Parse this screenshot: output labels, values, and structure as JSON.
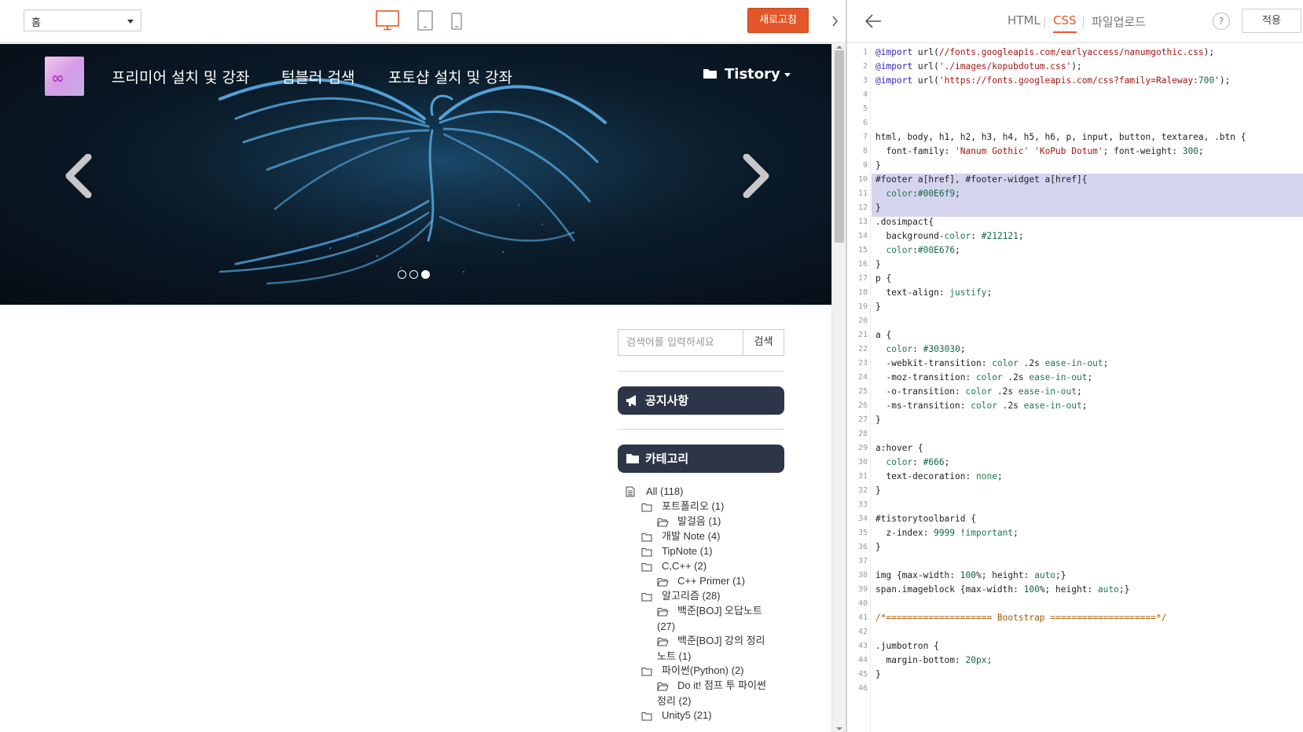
{
  "preview_toolbar": {
    "page_select_value": "홈",
    "device_icons": [
      "desktop-icon",
      "tablet-icon",
      "mobile-icon"
    ],
    "refresh_label": "새로고침",
    "accent_color": "#e4572a"
  },
  "blog": {
    "nav": [
      "프리미어 설치 및 강좌",
      "텀블러 검색",
      "포토샵 설치 및 강좌"
    ],
    "tistory_menu": "Tistory",
    "search_placeholder": "검색어를 입력하세요",
    "search_button": "검색",
    "notice_title": "공지사항",
    "category_title": "카테고리",
    "categories": [
      {
        "label": "All (118)",
        "level": 0,
        "icon": "document-icon"
      },
      {
        "label": "포트폴리오 (1)",
        "level": 1,
        "icon": "folder-icon"
      },
      {
        "label": "발걸음 (1)",
        "level": 2,
        "icon": "folder-open-icon"
      },
      {
        "label": "개발 Note (4)",
        "level": 1,
        "icon": "folder-icon"
      },
      {
        "label": "TipNote (1)",
        "level": 1,
        "icon": "folder-icon"
      },
      {
        "label": "C,C++ (2)",
        "level": 1,
        "icon": "folder-icon"
      },
      {
        "label": "C++ Primer (1)",
        "level": 2,
        "icon": "folder-open-icon"
      },
      {
        "label": "알고리즘 (28)",
        "level": 1,
        "icon": "folder-icon"
      },
      {
        "label": "백준[BOJ] 오답노트",
        "cont": "(27)",
        "level": 2,
        "icon": "folder-open-icon"
      },
      {
        "label": "백준[BOJ] 강의 정리",
        "cont": "노트 (1)",
        "level": 2,
        "icon": "folder-open-icon"
      },
      {
        "label": "파이썬(Python) (2)",
        "level": 1,
        "icon": "folder-icon"
      },
      {
        "label": "Do it! 점프 투 파이썬",
        "cont": "정리 (2)",
        "level": 2,
        "icon": "folder-open-icon"
      },
      {
        "label": "Unity5 (21)",
        "level": 1,
        "icon": "folder-icon"
      }
    ]
  },
  "editor": {
    "tabs": [
      "HTML",
      "CSS",
      "파일업로드"
    ],
    "active_tab": "CSS",
    "help_label": "?",
    "apply_label": "적용",
    "highlighted_lines": [
      10,
      11,
      12
    ],
    "code_lines": [
      "@import url(//fonts.googleapis.com/earlyaccess/nanumgothic.css);",
      "@import url('./images/kopubdotum.css');",
      "@import url('https://fonts.googleapis.com/css?family=Raleway:700');",
      "",
      "",
      "",
      "html, body, h1, h2, h3, h4, h5, h6, p, input, button, textarea, .btn {",
      "  font-family: 'Nanum Gothic' 'KoPub Dotum'; font-weight: 300;",
      "}",
      "#footer a[href], #footer-widget a[href]{",
      "  color:#00E6f9;",
      "}",
      ".dosimpact{",
      "  background-color: #212121;",
      "  color:#00E676;",
      "}",
      "p {",
      "  text-align: justify;",
      "}",
      "",
      "a {",
      "  color: #303030;",
      "  -webkit-transition: color .2s ease-in-out;",
      "  -moz-transition: color .2s ease-in-out;",
      "  -o-transition: color .2s ease-in-out;",
      "  -ms-transition: color .2s ease-in-out;",
      "}",
      "",
      "a:hover {",
      "  color: #666;",
      "  text-decoration: none;",
      "}",
      "",
      "#tistorytoolbarid {",
      "  z-index: 9999 !important;",
      "}",
      "",
      "img {max-width: 100%; height: auto;}",
      "span.imageblock {max-width: 100%; height: auto;}",
      "",
      "/*==================== Bootstrap ====================*/",
      "",
      ".jumbotron {",
      "  margin-bottom: 20px;",
      "}",
      ""
    ]
  }
}
